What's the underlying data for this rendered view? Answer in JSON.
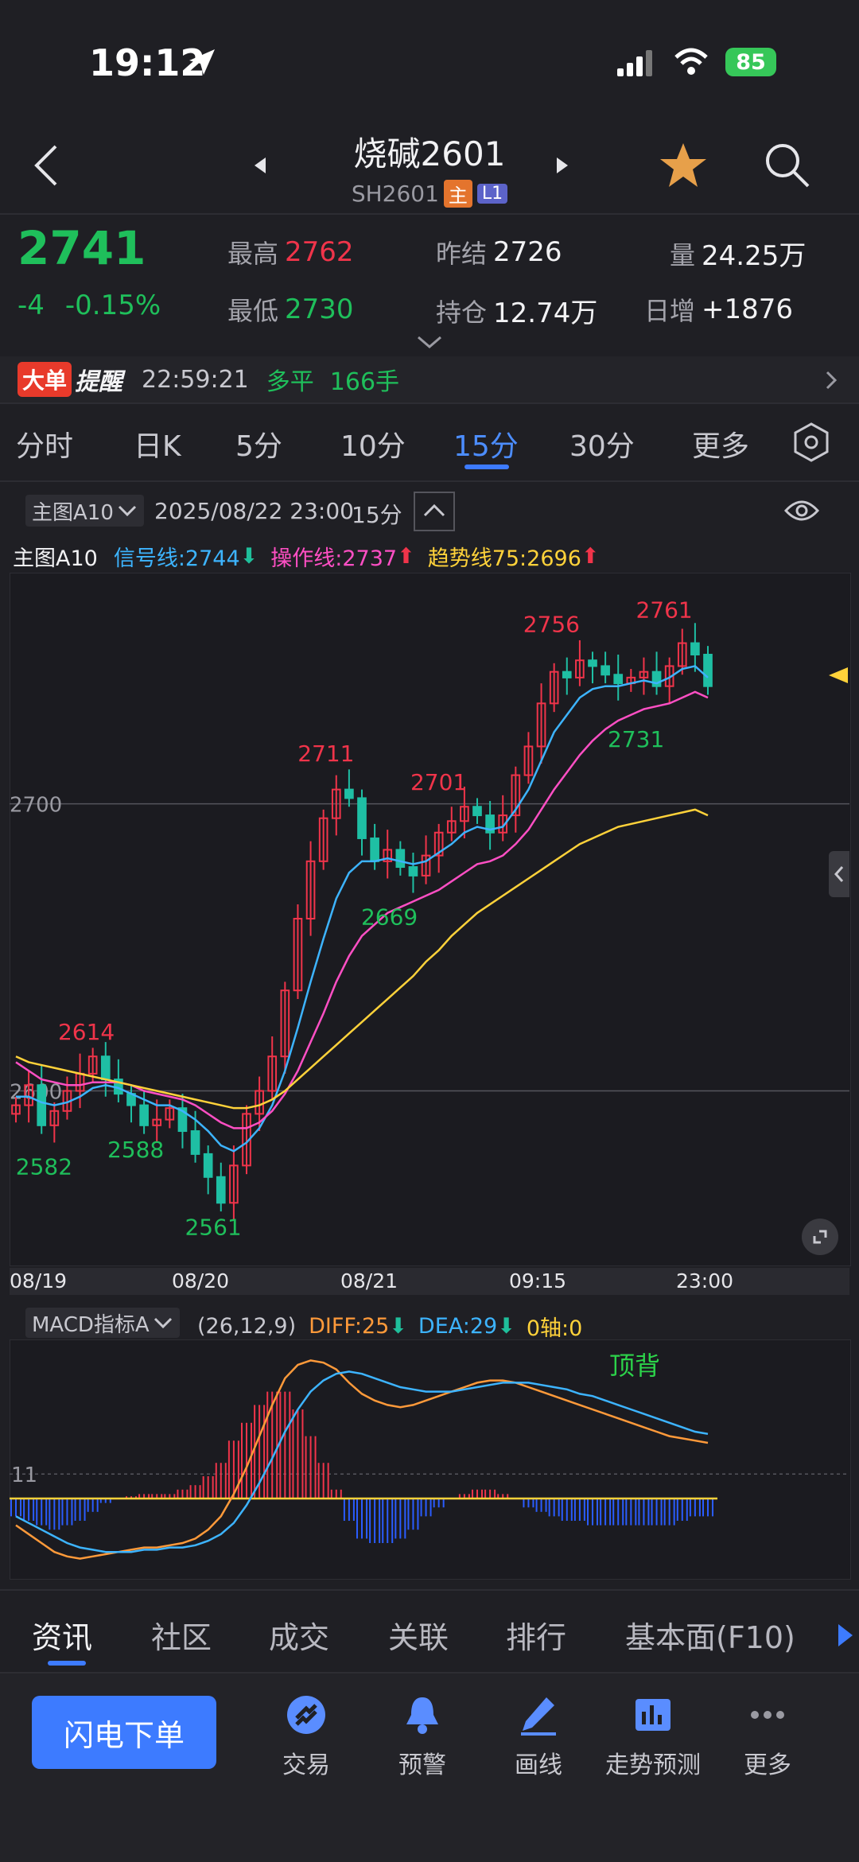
{
  "status": {
    "time": "19:12",
    "battery": "85"
  },
  "header": {
    "title": "烧碱2601",
    "code": "SH2601",
    "tag_main": "主",
    "tag_level": "L1"
  },
  "quote": {
    "last": "2741",
    "change": "-4",
    "change_pct": "-0.15%",
    "high_label": "最高",
    "high": "2762",
    "low_label": "最低",
    "low": "2730",
    "prev_settle_label": "昨结",
    "prev_settle": "2726",
    "oi_label": "持仓",
    "oi": "12.74万",
    "vol_label": "量",
    "vol": "24.25万",
    "daily_inc_label": "日增",
    "daily_inc": "+1876"
  },
  "alert": {
    "tag1": "大单",
    "tag2": "提醒",
    "time": "22:59:21",
    "type": "多平",
    "qty": "166手"
  },
  "period_tabs": [
    {
      "label": "分时",
      "active": false
    },
    {
      "label": "日K",
      "active": false
    },
    {
      "label": "5分",
      "active": false
    },
    {
      "label": "10分",
      "active": false
    },
    {
      "label": "15分",
      "active": true
    },
    {
      "label": "30分",
      "active": false
    },
    {
      "label": "更多",
      "active": false
    }
  ],
  "chart_toolbar": {
    "indicator": "主图A10",
    "datetime": "2025/08/22 23:00",
    "period": "15分"
  },
  "legend": {
    "name": "主图A10",
    "signal": "信号线:2744",
    "operate": "操作线:2737",
    "trend": "趋势线75:2696",
    "signal_color": "#3db4ff",
    "operate_color": "#ff4fc4",
    "trend_color": "#ffd23a"
  },
  "macd_toolbar": {
    "name": "MACD指标A",
    "params": "(26,12,9)",
    "diff": "DIFF:25",
    "dea": "DEA:29",
    "axis": "0轴:0",
    "note": "顶背"
  },
  "chart_data": [
    {
      "type": "candlestick",
      "title": "",
      "y_level_label": "2700",
      "y_level2_label": "2600",
      "ylim": [
        2545,
        2775
      ],
      "x_tick_labels": [
        "08/19",
        "08/20",
        "08/21",
        "09:15",
        "23:00"
      ],
      "annotations": {
        "highs": [
          "2614",
          "2711",
          "2701",
          "2756",
          "2761"
        ],
        "lows": [
          "2582",
          "2588",
          "2561",
          "2669",
          "2731"
        ]
      },
      "closes": [
        2595,
        2602,
        2588,
        2593,
        2600,
        2606,
        2612,
        2604,
        2599,
        2595,
        2588,
        2590,
        2594,
        2586,
        2578,
        2570,
        2561,
        2574,
        2592,
        2600,
        2612,
        2635,
        2660,
        2680,
        2695,
        2705,
        2702,
        2688,
        2680,
        2684,
        2678,
        2675,
        2682,
        2690,
        2694,
        2699,
        2696,
        2690,
        2696,
        2710,
        2720,
        2735,
        2746,
        2744,
        2750,
        2748,
        2745,
        2742,
        2744,
        2746,
        2741,
        2748,
        2756,
        2752,
        2741
      ],
      "series": [
        {
          "name": "信号线",
          "values": [
            2598,
            2598,
            2596,
            2595,
            2596,
            2598,
            2601,
            2602,
            2601,
            2599,
            2597,
            2595,
            2595,
            2593,
            2590,
            2586,
            2581,
            2579,
            2582,
            2587,
            2595,
            2607,
            2622,
            2638,
            2653,
            2667,
            2676,
            2680,
            2680,
            2681,
            2680,
            2679,
            2680,
            2683,
            2686,
            2690,
            2692,
            2691,
            2692,
            2698,
            2705,
            2715,
            2725,
            2731,
            2737,
            2740,
            2741,
            2741,
            2742,
            2743,
            2742,
            2744,
            2747,
            2748,
            2744
          ]
        },
        {
          "name": "操作线",
          "values": [
            2610,
            2607,
            2604,
            2603,
            2602,
            2602,
            2603,
            2603,
            2603,
            2602,
            2600,
            2599,
            2598,
            2597,
            2595,
            2592,
            2589,
            2587,
            2587,
            2589,
            2593,
            2599,
            2607,
            2617,
            2627,
            2638,
            2647,
            2654,
            2658,
            2662,
            2664,
            2666,
            2668,
            2670,
            2673,
            2676,
            2679,
            2680,
            2682,
            2686,
            2691,
            2698,
            2705,
            2711,
            2717,
            2722,
            2726,
            2729,
            2731,
            2733,
            2734,
            2735,
            2737,
            2739,
            2737
          ]
        },
        {
          "name": "趋势线75",
          "values": [
            2612,
            2610,
            2609,
            2608,
            2607,
            2606,
            2605,
            2604,
            2603,
            2602,
            2601,
            2600,
            2599,
            2598,
            2597,
            2596,
            2595,
            2594,
            2594,
            2595,
            2597,
            2600,
            2604,
            2608,
            2612,
            2616,
            2620,
            2624,
            2628,
            2632,
            2636,
            2640,
            2645,
            2649,
            2654,
            2658,
            2662,
            2665,
            2668,
            2671,
            2674,
            2677,
            2680,
            2683,
            2686,
            2688,
            2690,
            2692,
            2693,
            2694,
            2695,
            2696,
            2697,
            2698,
            2696
          ]
        }
      ]
    },
    {
      "type": "bar",
      "title": "",
      "y_level_label": "11",
      "series": [
        {
          "name": "DIFF",
          "values": [
            -12,
            -16,
            -20,
            -24,
            -26,
            -27,
            -26,
            -25,
            -24,
            -23,
            -22,
            -22,
            -21,
            -20,
            -18,
            -14,
            -8,
            2,
            14,
            28,
            42,
            54,
            60,
            62,
            61,
            58,
            52,
            47,
            44,
            42,
            41,
            42,
            44,
            46,
            48,
            50,
            52,
            53,
            53,
            52,
            50,
            48,
            46,
            44,
            42,
            40,
            38,
            36,
            34,
            32,
            30,
            28,
            27,
            26,
            25
          ]
        },
        {
          "name": "DEA",
          "values": [
            -8,
            -11,
            -14,
            -17,
            -20,
            -22,
            -23,
            -24,
            -24,
            -24,
            -23,
            -23,
            -22,
            -22,
            -21,
            -19,
            -16,
            -11,
            -3,
            7,
            18,
            30,
            40,
            48,
            53,
            56,
            57,
            56,
            54,
            52,
            50,
            49,
            48,
            48,
            48,
            49,
            50,
            51,
            52,
            52,
            52,
            51,
            50,
            49,
            47,
            46,
            44,
            42,
            40,
            38,
            36,
            34,
            32,
            30,
            29
          ]
        },
        {
          "name": "MACD",
          "values": [
            -8,
            -10,
            -12,
            -14,
            -12,
            -10,
            -6,
            -2,
            0,
            1,
            2,
            2,
            2,
            4,
            6,
            10,
            16,
            26,
            34,
            42,
            48,
            48,
            40,
            28,
            16,
            4,
            -10,
            -18,
            -20,
            -20,
            -18,
            -14,
            -8,
            -4,
            0,
            2,
            4,
            4,
            2,
            0,
            -4,
            -6,
            -8,
            -10,
            -10,
            -12,
            -12,
            -12,
            -12,
            -12,
            -12,
            -12,
            -10,
            -8,
            -8
          ]
        }
      ]
    }
  ],
  "bottom_tabs": [
    "资讯",
    "社区",
    "成交",
    "关联",
    "排行",
    "基本面(F10)"
  ],
  "action_bar": {
    "flash_order": "闪电下单",
    "items": [
      {
        "label": "交易",
        "icon": "trade-icon"
      },
      {
        "label": "预警",
        "icon": "bell-icon"
      },
      {
        "label": "画线",
        "icon": "pen-icon"
      },
      {
        "label": "走势预测",
        "icon": "book-chart-icon"
      },
      {
        "label": "更多",
        "icon": "more-dots-icon"
      }
    ]
  }
}
